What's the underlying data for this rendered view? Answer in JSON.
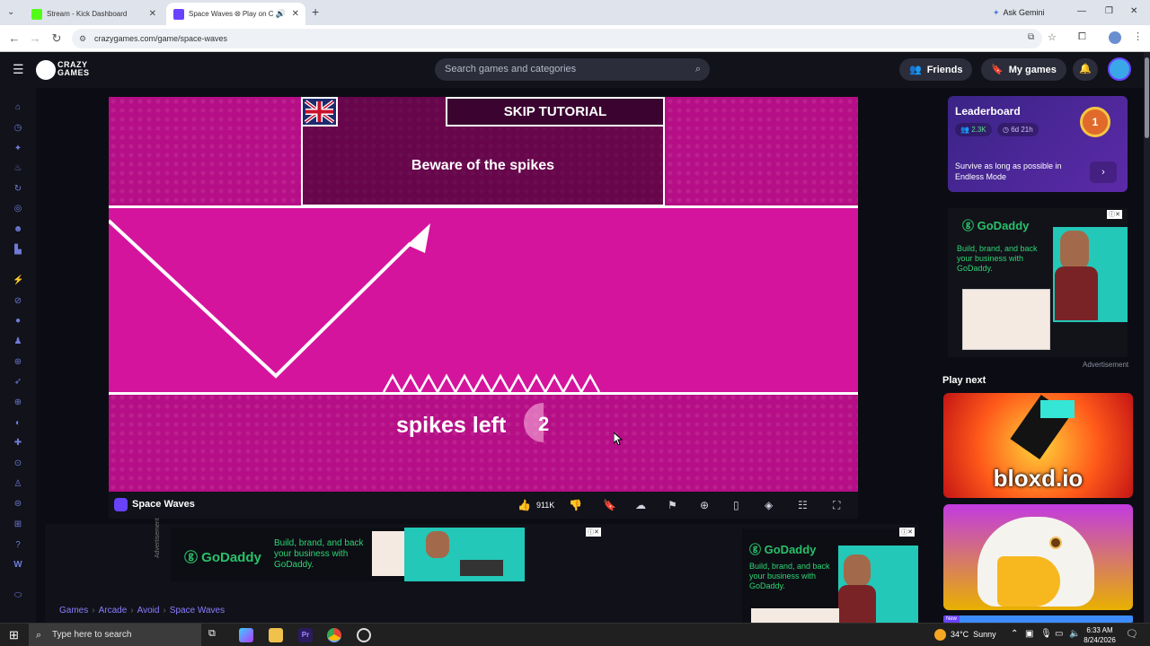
{
  "browser": {
    "tabs": [
      {
        "title": "Stream - Kick Dashboard",
        "active": false
      },
      {
        "title": "Space Waves ⭙ Play on C",
        "active": true
      }
    ],
    "new_tab": "+",
    "ask_gemini": "Ask Gemini",
    "url": "crazygames.com/game/space-waves"
  },
  "site": {
    "logo_line1": "CRAZY",
    "logo_line2": "GAMES",
    "search_placeholder": "Search games and categories",
    "friends_label": "Friends",
    "my_games_label": "My games"
  },
  "game": {
    "skip_label": "SKIP TUTORIAL",
    "tutorial_text": "Beware of the spikes",
    "spikes_label": "spikes left",
    "spikes_count": "2"
  },
  "gamebar": {
    "title": "Space Waves",
    "likes": "911K"
  },
  "leaderboard": {
    "title": "Leaderboard",
    "players": "2.3K",
    "time_left": "6d 21h",
    "rank": "1",
    "description": "Survive as long as possible in Endless Mode"
  },
  "ads": {
    "brand": "GoDaddy",
    "tagline": "Build, brand, and back your business with GoDaddy.",
    "advertisement_label": "Advertisement",
    "vertical_label": "Advertisement"
  },
  "play_next": {
    "heading": "Play next",
    "games": [
      {
        "name": "bloxd.io",
        "badge": ""
      },
      {
        "name": "",
        "badge": "New"
      }
    ]
  },
  "breadcrumb": [
    "Games",
    "Arcade",
    "Avoid",
    "Space Waves"
  ],
  "taskbar": {
    "search_placeholder": "Type here to search",
    "weather": "34°C  Sunny",
    "time": "6:33 AM",
    "date": "8/24/2026"
  },
  "colors": {
    "accent": "#6842ff",
    "game_magenta": "#d5149d",
    "game_dark": "#b60e86"
  }
}
